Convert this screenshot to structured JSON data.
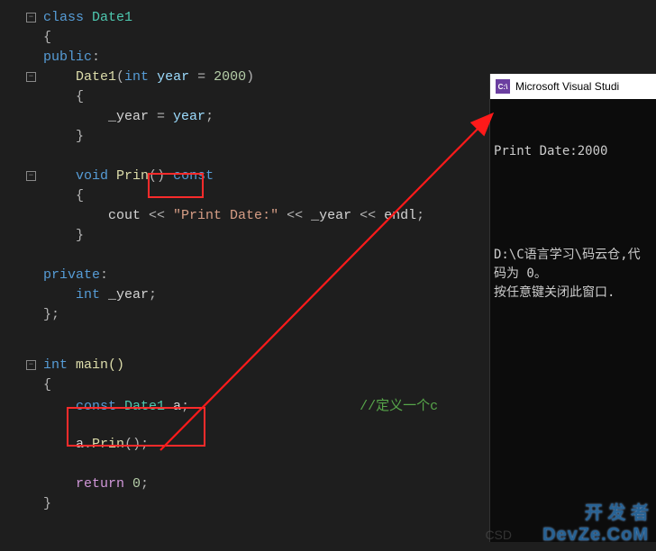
{
  "code": {
    "l1_class": "class",
    "l1_name": " Date1",
    "l2_brace": "{",
    "l3_public": "public",
    "l3_colon": ":",
    "l4_ctor": "Date1",
    "l4_int": "int",
    "l4_param": " year ",
    "l4_eq": "= ",
    "l4_num": "2000",
    "l5_brace": "{",
    "l6_ident": "_year ",
    "l6_eq": "= ",
    "l6_param": "year",
    "l6_semi": ";",
    "l7_brace": "}",
    "l9_void": "void",
    "l9_fn": " Prin",
    "l9_paren": "() ",
    "l9_const": "const",
    "l10_brace": "{",
    "l11_cout": "cout ",
    "l11_op": "<< ",
    "l11_str": "\"Print Date:\"",
    "l11_op2": " << ",
    "l11_year": "_year",
    "l11_op3": " << ",
    "l11_endl": "endl",
    "l11_semi": ";",
    "l12_brace": "}",
    "l14_private": "private",
    "l14_colon": ":",
    "l15_int": "int",
    "l15_name": " _year",
    "l15_semi": ";",
    "l16_close": "};"
  },
  "main": {
    "l1_int": "int",
    "l1_main": " main()",
    "l2_brace": "{",
    "l3_const": "const",
    "l3_type": " Date1",
    "l3_var": " a",
    "l3_semi": ";",
    "l3_comment": "//定义一个c",
    "l5_a": "a",
    "l5_dot": ".",
    "l5_fn": "Prin",
    "l5_paren": "()",
    "l5_semi": ";",
    "l7_return": "return",
    "l7_zero": " 0",
    "l7_semi": ";",
    "l8_brace": "}"
  },
  "console": {
    "title": "Microsoft Visual Studi",
    "icon": "C:\\",
    "out1": "Print Date:2000",
    "out2": "D:\\C语言学习\\码云仓,代码为 0。\n按任意键关闭此窗口."
  },
  "watermark": {
    "line1": "开 发 者",
    "line2": "DevZe.CoM"
  },
  "csdn": "CSD"
}
